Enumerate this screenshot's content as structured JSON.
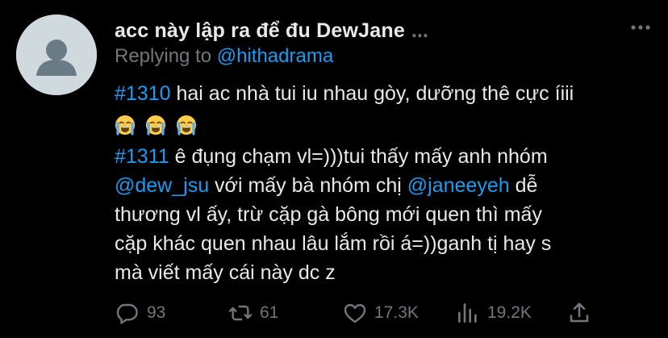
{
  "tweet": {
    "display_name": "acc này lập ra để đu DewJane",
    "truncation": "...",
    "replying_prefix": "Replying to",
    "replying_to": "@hithadrama",
    "lines": [
      [
        {
          "t": "#1310",
          "c": "tag"
        },
        {
          "t": " hai ac nhà tui iu nhau gòy, dưỡng thê cực íiii",
          "c": ""
        }
      ],
      [
        {
          "t": "#1311",
          "c": "tag"
        },
        {
          "t": " ê đụng chạm vl=)))tui thấy mấy anh nhóm",
          "c": ""
        }
      ],
      [
        {
          "t": "@dew_jsu",
          "c": "tag"
        },
        {
          "t": " với mấy bà nhóm chị ",
          "c": ""
        },
        {
          "t": "@janeeyeh",
          "c": "tag"
        },
        {
          "t": " dễ",
          "c": ""
        }
      ],
      [
        {
          "t": "thương vl ấy, trừ cặp gà bông mới quen thì mấy",
          "c": ""
        }
      ],
      [
        {
          "t": "cặp khác quen nhau lâu lắm rồi á=))ganh tị hay s",
          "c": ""
        }
      ],
      [
        {
          "t": "mà viết mấy cái này dc z",
          "c": ""
        }
      ]
    ],
    "emojis": [
      "loudly-crying-face-icon",
      "loudly-crying-face-icon",
      "loudly-crying-face-icon"
    ]
  },
  "actions": {
    "reply_count": "93",
    "retweet_count": "61",
    "like_count": "17.3K",
    "view_count": "19.2K"
  },
  "colors": {
    "background": "#000000",
    "text": "#e7e9ea",
    "secondary": "#71767b",
    "accent": "#1d9bf0"
  }
}
